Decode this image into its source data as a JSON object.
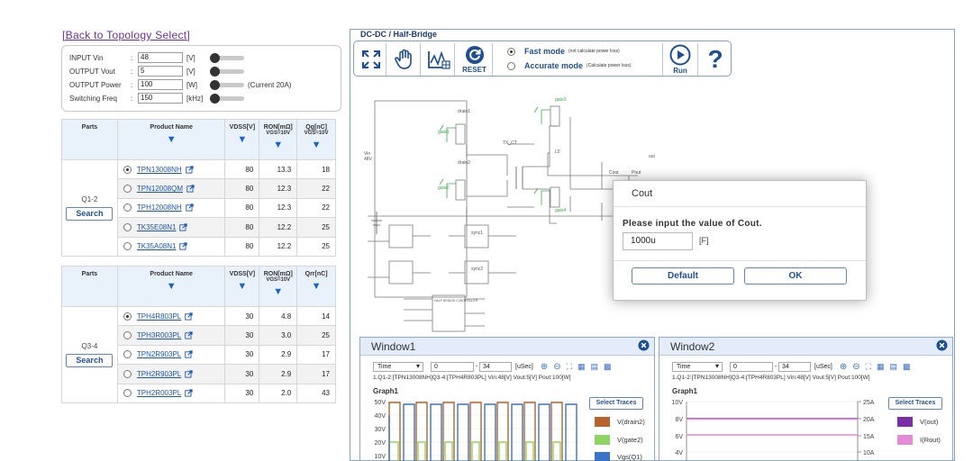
{
  "left": {
    "back_link": "[Back to Topology Select]",
    "inputs": [
      {
        "label": "INPUT Vin",
        "value": "48",
        "unit": "[V]",
        "note": ""
      },
      {
        "label": "OUTPUT Vout",
        "value": "5",
        "unit": "[V]",
        "note": ""
      },
      {
        "label": "OUTPUT Power",
        "value": "100",
        "unit": "[W]",
        "note": "(Current 20A)"
      },
      {
        "label": "Switching Freq",
        "value": "150",
        "unit": "[kHz]",
        "note": ""
      }
    ],
    "table1": {
      "headers": {
        "parts": "Parts",
        "product": "Product Name",
        "vdss": "VDSS[V]",
        "ron": "RON[mΩ]",
        "ron_sub": "VGS=10V",
        "qg": "Qg[nC]",
        "qg_sub": "VGS=10V"
      },
      "group": "Q1-2",
      "search": "Search",
      "rows": [
        {
          "name": "TPN13008NH",
          "vdss": "80",
          "ron": "13.3",
          "qg": "18",
          "selected": true
        },
        {
          "name": "TPN12008QM",
          "vdss": "80",
          "ron": "12.3",
          "qg": "22",
          "selected": false
        },
        {
          "name": "TPH12008NH",
          "vdss": "80",
          "ron": "12.3",
          "qg": "22",
          "selected": false
        },
        {
          "name": "TK35E08N1",
          "vdss": "80",
          "ron": "12.2",
          "qg": "25",
          "selected": false
        },
        {
          "name": "TK35A08N1",
          "vdss": "80",
          "ron": "12.2",
          "qg": "25",
          "selected": false
        }
      ]
    },
    "table2": {
      "headers": {
        "parts": "Parts",
        "product": "Product Name",
        "vdss": "VDSS[V]",
        "ron": "RON[mΩ]",
        "ron_sub": "VGS=10V",
        "qg": "Qrr[nC]"
      },
      "group": "Q3-4",
      "search": "Search",
      "rows": [
        {
          "name": "TPH4R803PL",
          "vdss": "30",
          "ron": "4.8",
          "qg": "14",
          "selected": true
        },
        {
          "name": "TPH3R003PL",
          "vdss": "30",
          "ron": "3.0",
          "qg": "25",
          "selected": false
        },
        {
          "name": "TPN2R903PL",
          "vdss": "30",
          "ron": "2.9",
          "qg": "17",
          "selected": false
        },
        {
          "name": "TPH2R903PL",
          "vdss": "30",
          "ron": "2.9",
          "qg": "17",
          "selected": false
        },
        {
          "name": "TPH2R003PL",
          "vdss": "30",
          "ron": "2.0",
          "qg": "43",
          "selected": false
        }
      ]
    }
  },
  "right": {
    "title": "DC-DC / Half-Bridge",
    "toolbar": {
      "reset": "RESET",
      "fast_mode": "Fast mode",
      "fast_note": "(not calculate power loss)",
      "accurate_mode": "Accurate mode",
      "accurate_note": "(Calculate power loss)",
      "run": "Run",
      "help": "?"
    },
    "circuit": {
      "vin": "Vin",
      "vin_val": "48V",
      "transformer": "TX_CT",
      "inductor": "L0",
      "out": "out",
      "iout": "Cout",
      "pout": "Pout",
      "gate_labels": [
        "gate1",
        "gate2",
        "gate3",
        "gate4"
      ],
      "drain_labels": [
        "drain1",
        "drain2"
      ],
      "ic": "HALF BRIDGE CONTROLLER",
      "sync": [
        "sync1",
        "sync2"
      ]
    },
    "dialog": {
      "title": "Cout",
      "message": "Please input the value of Cout.",
      "value": "1000u",
      "unit": "[F]",
      "default_btn": "Default",
      "ok_btn": "OK"
    },
    "window1": {
      "title": "Window1",
      "axis": "Time",
      "from": "0",
      "to": "34",
      "unit": "[uSec]",
      "info": "1.Q1-2:[TPN13008NH]Q3-4:[TPH4R803PL] Vin:48[V] Vout:5[V] Pout:100[W]",
      "graph": "Graph1",
      "select_traces": "Select Traces",
      "yticks": [
        "50V",
        "40V",
        "30V",
        "20V",
        "10V"
      ],
      "legend": [
        {
          "label": "V(drain2)",
          "color": "#b8632c"
        },
        {
          "label": "V(gate2)",
          "color": "#8fd364"
        },
        {
          "label": "Vgs(Q1)",
          "color": "#3a74c6"
        }
      ]
    },
    "window2": {
      "title": "Window2",
      "axis": "Time",
      "from": "0",
      "to": "34",
      "unit": "[uSec]",
      "info": "1.Q1-2:[TPN13008NH]Q3-4:[TPH4R803PL] Vin:48[V] Vout:5[V] Pout:100[W]",
      "graph": "Graph1",
      "select_traces": "Select Traces",
      "yticks_left": [
        "10V",
        "8V",
        "6V",
        "4V"
      ],
      "yticks_right": [
        "25A",
        "20A",
        "15A",
        "10A"
      ],
      "legend": [
        {
          "label": "V(out)",
          "color": "#7a2fa8"
        },
        {
          "label": "I(Rout)",
          "color": "#e58ad6"
        }
      ]
    }
  }
}
